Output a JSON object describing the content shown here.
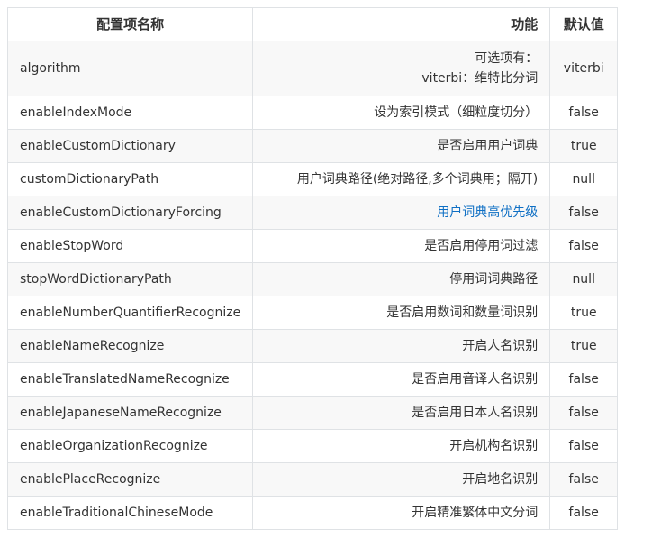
{
  "table": {
    "headers": {
      "name": "配置项名称",
      "function": "功能",
      "default": "默认值"
    },
    "rows": [
      {
        "name": "algorithm",
        "function_lines": [
          "可选项有：",
          "viterbi：维特比分词"
        ],
        "default": "viterbi"
      },
      {
        "name": "enableIndexMode",
        "function": "设为索引模式（细粒度切分）",
        "default": "false"
      },
      {
        "name": "enableCustomDictionary",
        "function": "是否启用用户词典",
        "default": "true"
      },
      {
        "name": "customDictionaryPath",
        "function": "用户词典路径(绝对路径,多个词典用；隔开)",
        "default": "null"
      },
      {
        "name": "enableCustomDictionaryForcing",
        "function": "用户词典高优先级",
        "default": "false",
        "function_is_link": true
      },
      {
        "name": "enableStopWord",
        "function": "是否启用停用词过滤",
        "default": "false"
      },
      {
        "name": "stopWordDictionaryPath",
        "function": "停用词词典路径",
        "default": "null"
      },
      {
        "name": "enableNumberQuantifierRecognize",
        "function": "是否启用数词和数量词识别",
        "default": "true"
      },
      {
        "name": "enableNameRecognize",
        "function": "开启人名识别",
        "default": "true"
      },
      {
        "name": "enableTranslatedNameRecognize",
        "function": "是否启用音译人名识别",
        "default": "false"
      },
      {
        "name": "enableJapaneseNameRecognize",
        "function": "是否启用日本人名识别",
        "default": "false"
      },
      {
        "name": "enableOrganizationRecognize",
        "function": "开启机构名识别",
        "default": "false"
      },
      {
        "name": "enablePlaceRecognize",
        "function": "开启地名识别",
        "default": "false"
      },
      {
        "name": "enableTraditionalChineseMode",
        "function": "开启精准繁体中文分词",
        "default": "false"
      }
    ]
  },
  "colors": {
    "border": "#dfe2e5",
    "row_alt": "#f8f8f8",
    "text": "#333333",
    "link": "#0e6fc4"
  }
}
